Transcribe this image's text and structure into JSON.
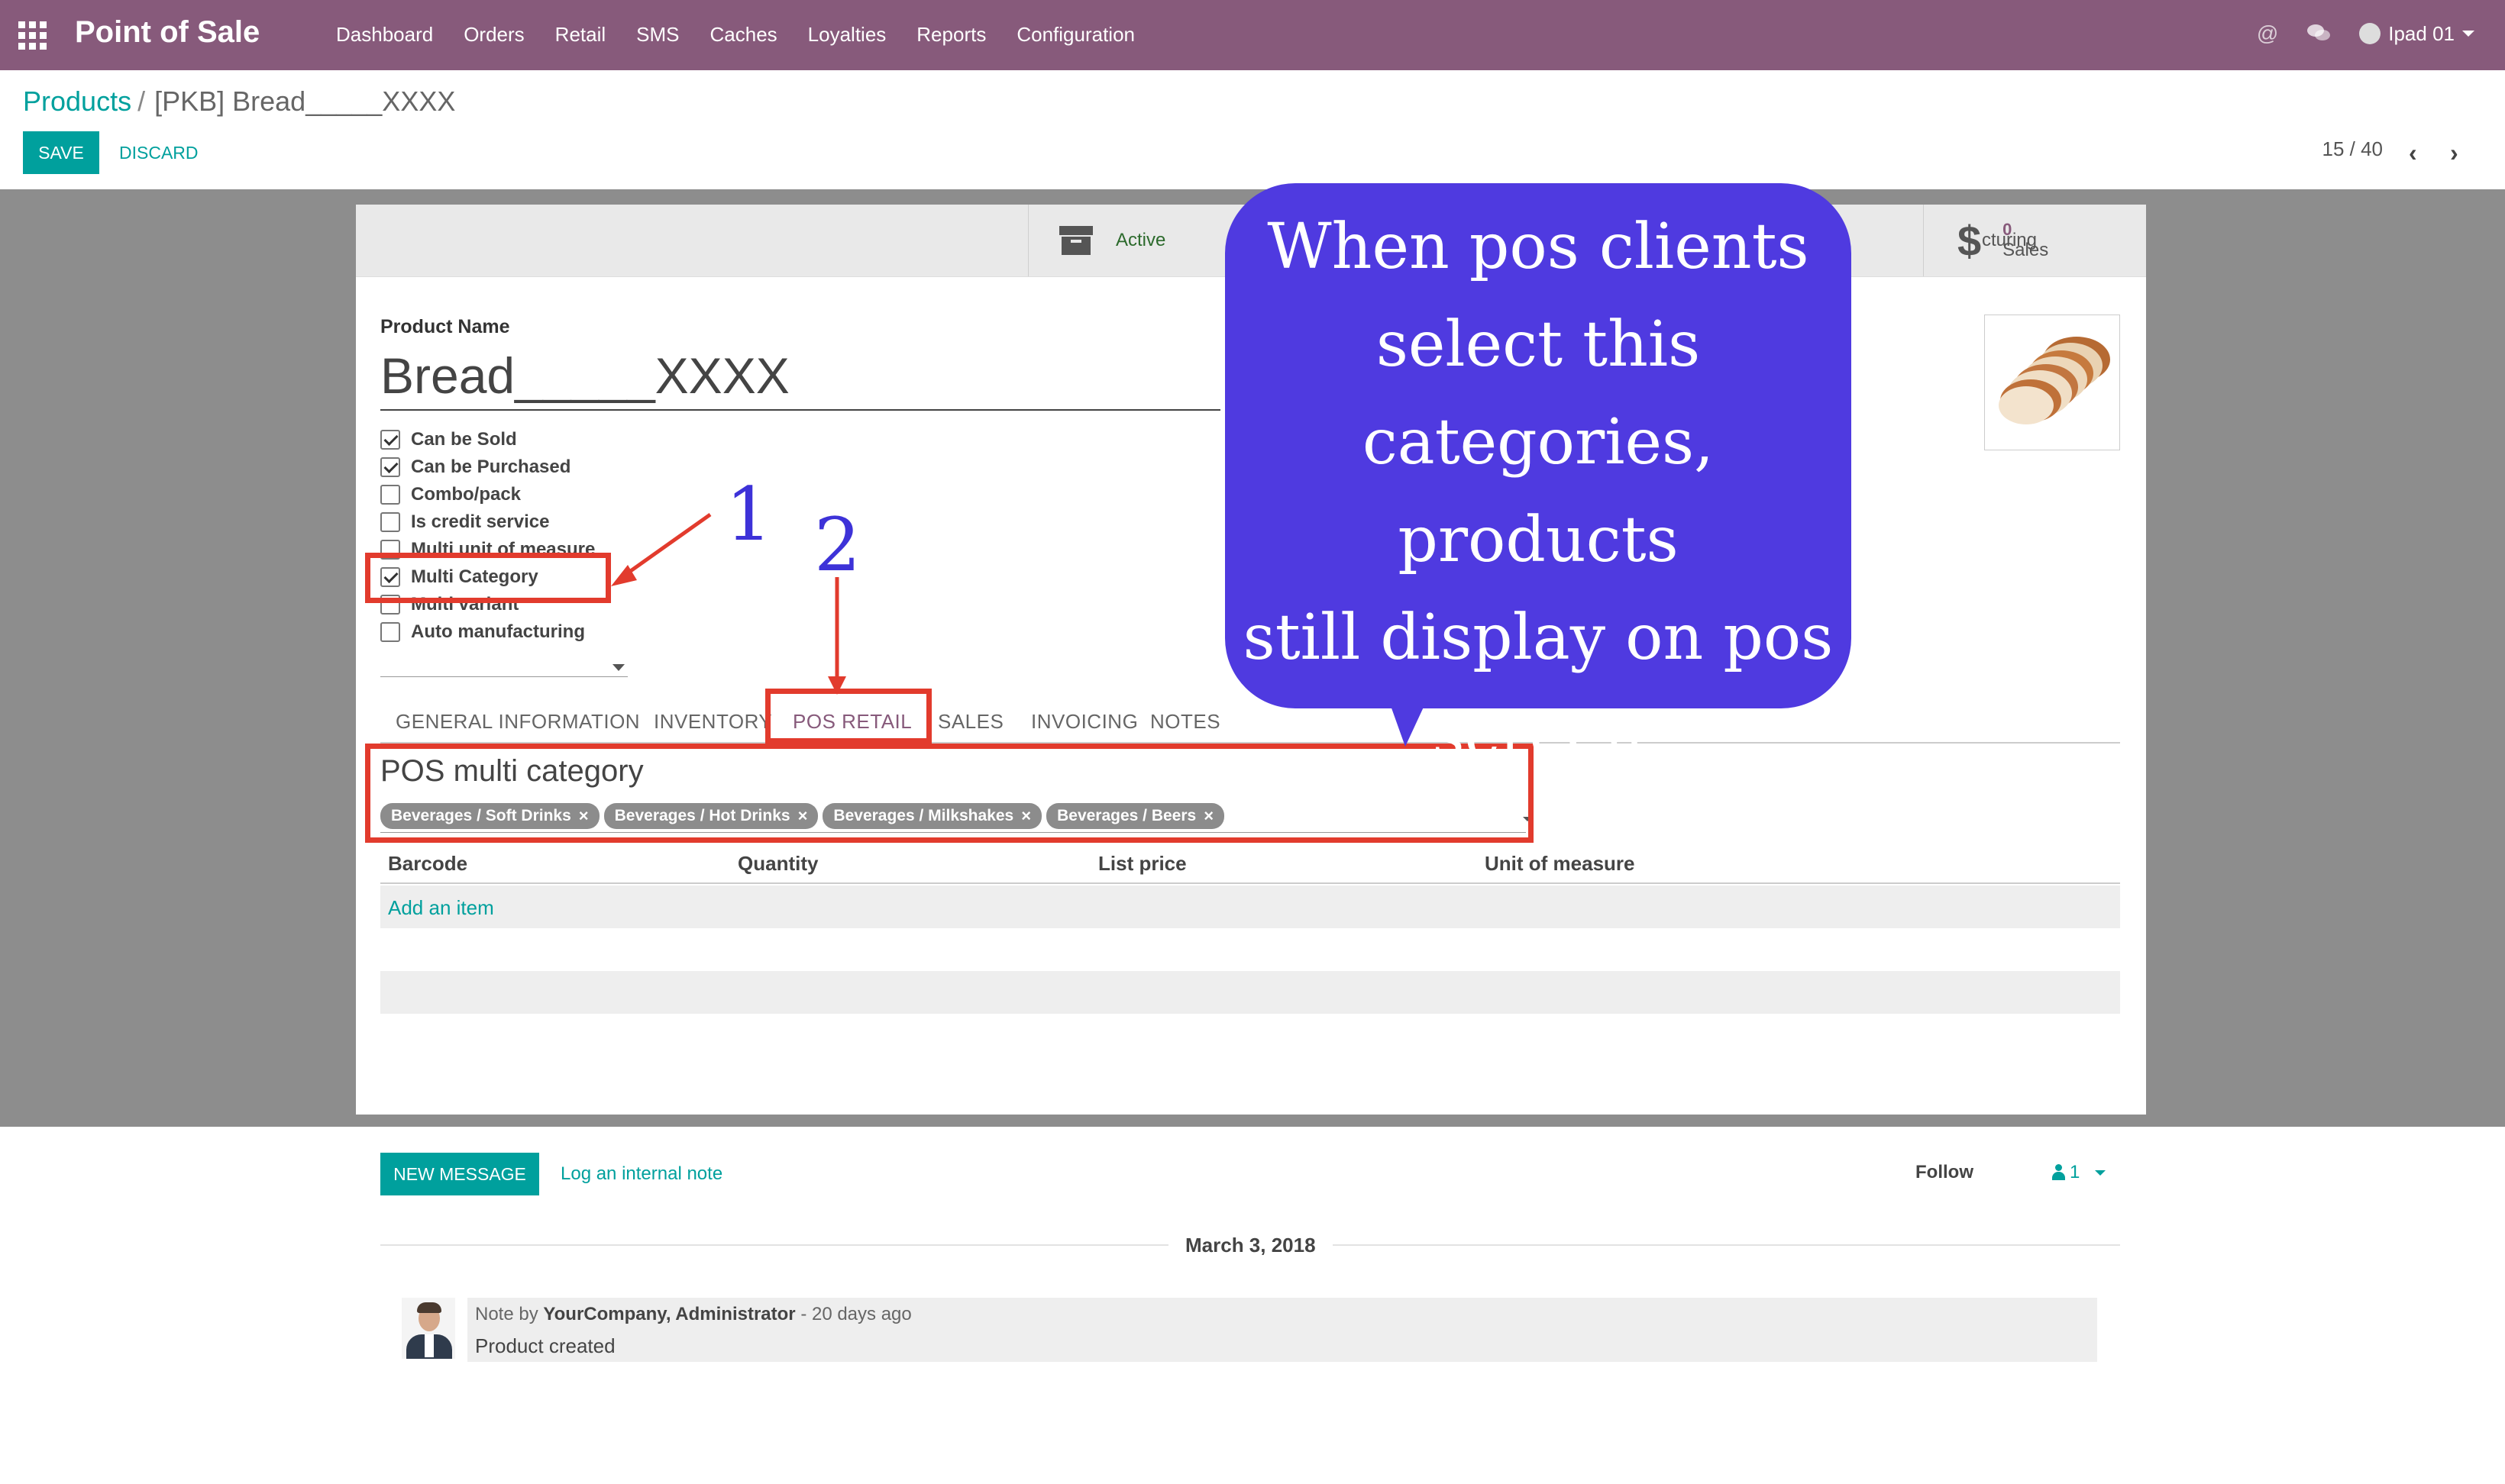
{
  "nav": {
    "brand": "Point of Sale",
    "menu": [
      "Dashboard",
      "Orders",
      "Retail",
      "SMS",
      "Caches",
      "Loyalties",
      "Reports",
      "Configuration"
    ],
    "user": "Ipad 01"
  },
  "breadcrumb": {
    "parent": "Products",
    "separator": "/",
    "current": "[PKB] Bread_____XXXX"
  },
  "actions": {
    "save": "SAVE",
    "discard": "DISCARD"
  },
  "pager": {
    "value": "15 / 40"
  },
  "stat_buttons": {
    "active": "Active",
    "manufacturing_partial": "cturing",
    "sales_count": "0",
    "sales_label": "Sales"
  },
  "form": {
    "product_name_label": "Product Name",
    "product_name": "Bread_____XXXX",
    "checkboxes": [
      {
        "label": "Can be Sold",
        "checked": true
      },
      {
        "label": "Can be Purchased",
        "checked": true
      },
      {
        "label": "Combo/pack",
        "checked": false
      },
      {
        "label": "Is credit service",
        "checked": false
      },
      {
        "label": "Multi unit of measure",
        "checked": false
      },
      {
        "label": "Multi Category",
        "checked": true
      },
      {
        "label": "Multi variant",
        "checked": false
      },
      {
        "label": "Auto manufacturing",
        "checked": false
      }
    ],
    "tabs": [
      "GENERAL INFORMATION",
      "INVENTORY",
      "POS RETAIL",
      "SALES",
      "INVOICING",
      "NOTES"
    ],
    "active_tab": "POS RETAIL",
    "pos_multi_category_title": "POS multi category",
    "category_tags": [
      "Beverages / Soft Drinks",
      "Beverages / Hot Drinks",
      "Beverages / Milkshakes",
      "Beverages / Beers"
    ],
    "table_headers": [
      "Barcode",
      "Quantity",
      "List price",
      "Unit of measure"
    ],
    "add_item": "Add an item"
  },
  "annotations": {
    "marker_1": "1",
    "marker_2": "2",
    "callout_lines": [
      "When pos clients",
      "select this",
      "categories, products",
      "still display on pos",
      "screen"
    ],
    "callout_color": "#4f3ae0",
    "box_color": "#e23b2d"
  },
  "chatter": {
    "new_message": "NEW MESSAGE",
    "log_note": "Log an internal note",
    "follow": "Follow",
    "followers_count": "1",
    "date": "March 3, 2018",
    "message_prefix": "Note by",
    "message_author": "YourCompany, Administrator",
    "message_time": "- 20 days ago",
    "message_body": "Product created"
  },
  "colors": {
    "nav_bg": "#875a7b",
    "primary": "#00a09d"
  }
}
